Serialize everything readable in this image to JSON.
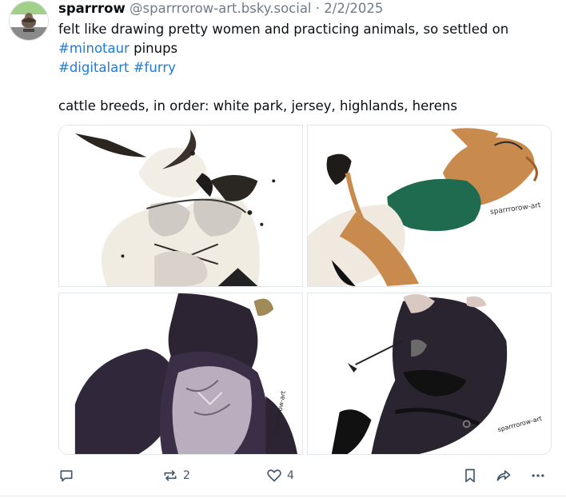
{
  "post": {
    "author_name": "sparrrow",
    "author_handle": "@sparrrorow-art.bsky.social",
    "separator": "·",
    "date": "2/2/2025",
    "text_line1": "felt like drawing pretty women and practicing animals, so settled on",
    "tag_minotaur": "#minotaur",
    "text_pinups": " pinups",
    "tag_digitalart": "#digitalart",
    "tag_furry": "#furry",
    "text_line4": "cattle breeds, in order: white park, jersey, highlands, herens"
  },
  "images": [
    {
      "name": "white-park-artwork",
      "signature": ""
    },
    {
      "name": "jersey-artwork",
      "signature": "sparrrorow-art"
    },
    {
      "name": "highlands-artwork",
      "signature": "sparrrorow-art"
    },
    {
      "name": "herens-artwork",
      "signature": "sparrrorow-art"
    }
  ],
  "actions": {
    "reply_count": "",
    "repost_count": "2",
    "like_count": "4"
  },
  "icons": [
    "reply-icon",
    "repost-icon",
    "like-icon",
    "bookmark-icon",
    "share-icon",
    "more-icon"
  ],
  "colors": {
    "link": "#1a7ce0",
    "muted": "#6f7b89",
    "action": "#42576c"
  }
}
